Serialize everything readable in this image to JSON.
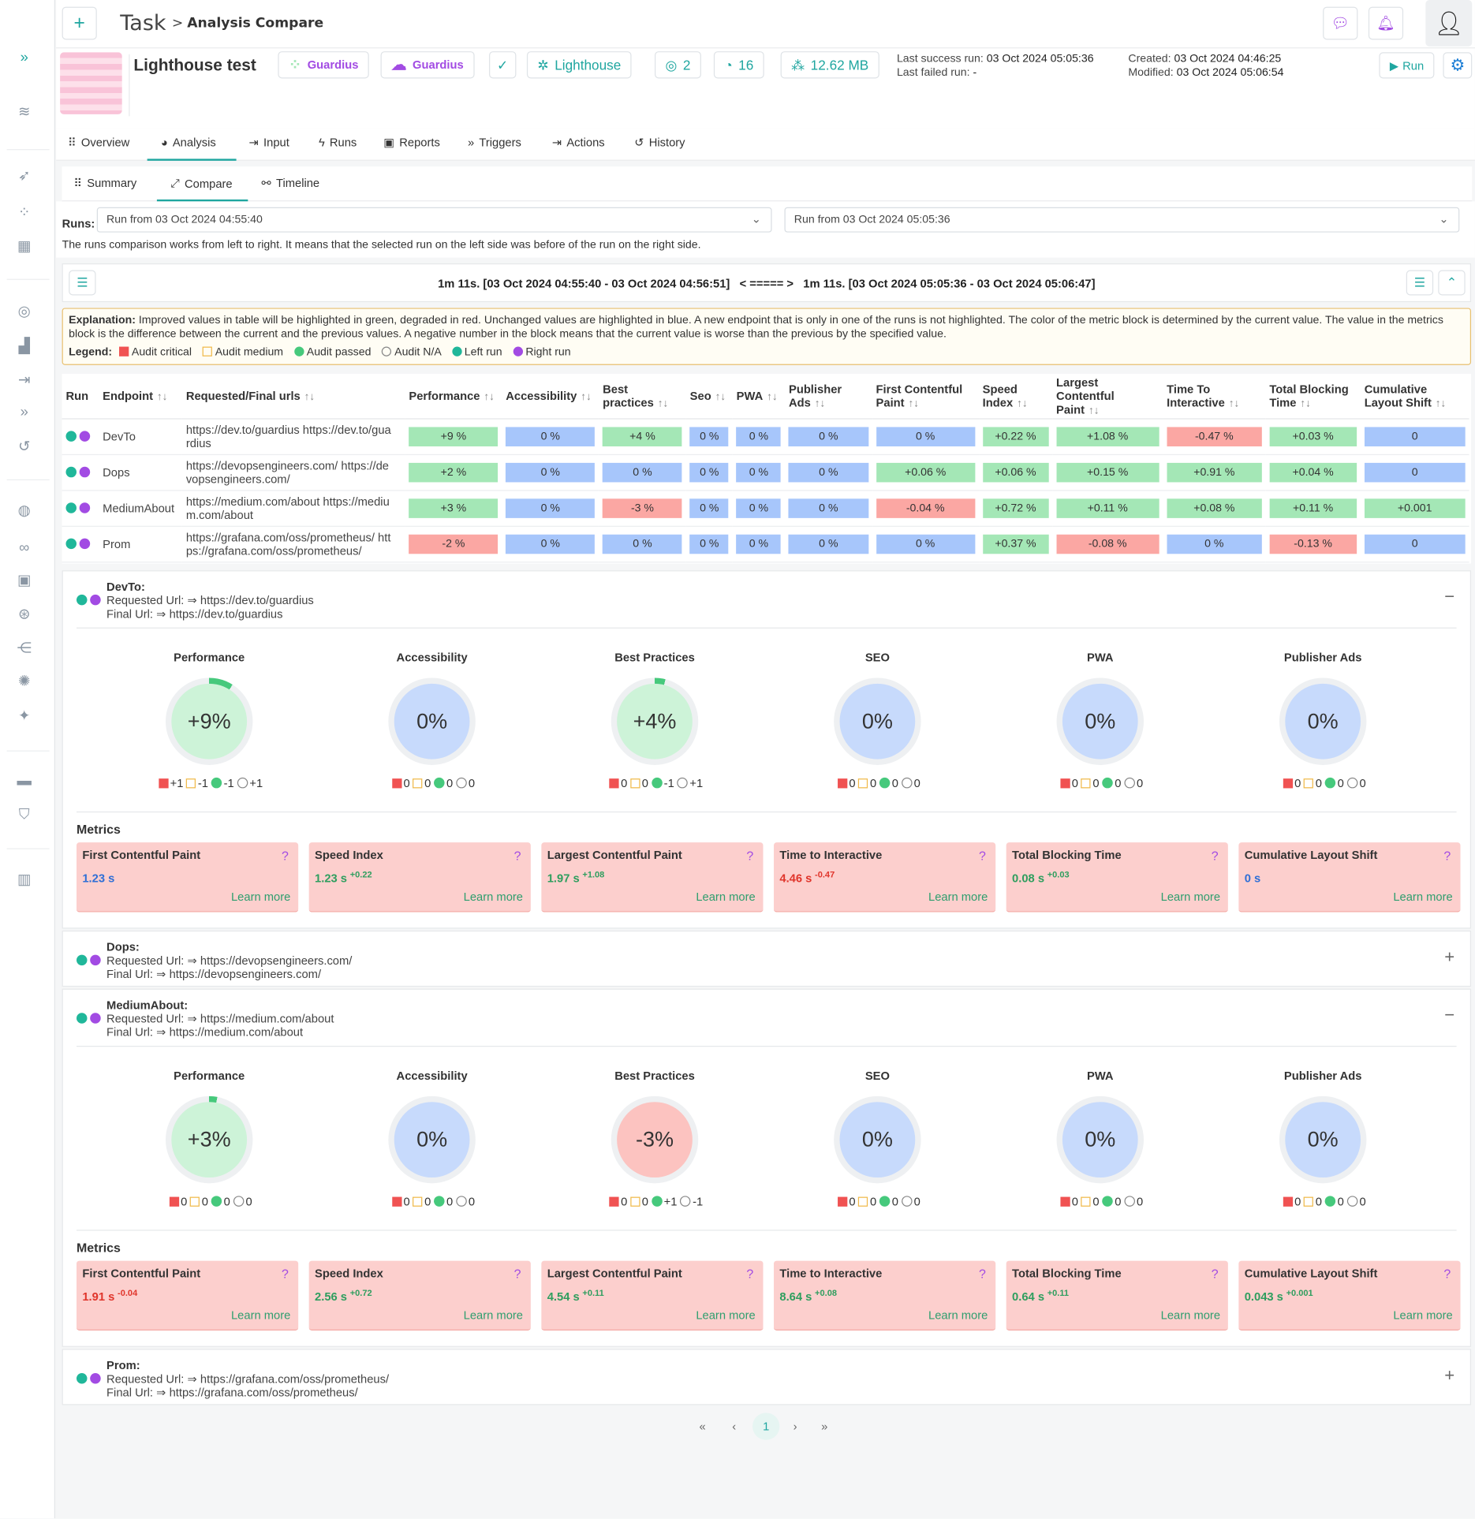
{
  "header": {
    "title": "Task",
    "crumb": "Analysis Compare",
    "plus": "+"
  },
  "task": {
    "name": "Lighthouse test",
    "tags": [
      "Guardius",
      "Guardius"
    ],
    "tool": "Lighthouse",
    "count_a": "2",
    "count_b": "16",
    "size": "12.62 MB",
    "last_success_label": "Last success run:",
    "last_success": "03 Oct 2024 05:05:36",
    "last_failed_label": "Last failed run:",
    "last_failed": "-",
    "created_label": "Created:",
    "created": "03 Oct 2024 04:46:25",
    "modified_label": "Modified:",
    "modified": "03 Oct 2024 05:06:54",
    "run_label": "Run"
  },
  "tabs": [
    "Overview",
    "Analysis",
    "Input",
    "Runs",
    "Reports",
    "Triggers",
    "Actions",
    "History"
  ],
  "subtabs": [
    "Summary",
    "Compare",
    "Timeline"
  ],
  "runs": {
    "label": "Runs:",
    "left": "Run from 03 Oct 2024 04:55:40",
    "right": "Run from 03 Oct 2024 05:05:36",
    "note": "The runs comparison works from left to right. It means that the selected run on the left side was before of the run on the right side.",
    "summary": "1m 11s. [03 Oct 2024 04:55:40 - 03 Oct 2024 04:56:51]   < ===== >   1m 11s. [03 Oct 2024 05:05:36 - 03 Oct 2024 05:06:47]"
  },
  "explanation": {
    "label": "Explanation:",
    "text": "Improved values in table will be highlighted in green, degraded in red. Unchanged values are highlighted in blue. A new endpoint that is only in one of the runs is not highlighted. The color of the metric block is determined by the current value. The value in the metrics block is the difference between the current and the previous values. A negative number in the block means that the current value is worse than the previous by the specified value.",
    "legend_label": "Legend:",
    "legend": [
      "Audit critical",
      "Audit medium",
      "Audit passed",
      "Audit N/A",
      "Left run",
      "Right run"
    ]
  },
  "table": {
    "headers": [
      "Run",
      "Endpoint",
      "Requested/Final urls",
      "Performance",
      "Accessibility",
      "Best practices",
      "Seo",
      "PWA",
      "Publisher Ads",
      "First Contentful Paint",
      "Speed Index",
      "Largest Contentful Paint",
      "Time To Interactive",
      "Total Blocking Time",
      "Cumulative Layout Shift"
    ],
    "rows": [
      {
        "endpoint": "DevTo",
        "urls": "https://dev.to/guardius https://dev.to/guardius",
        "cells": [
          [
            "+9 %",
            "g"
          ],
          [
            "0 %",
            "b"
          ],
          [
            "+4 %",
            "g"
          ],
          [
            "0 %",
            "b"
          ],
          [
            "0 %",
            "b"
          ],
          [
            "0 %",
            "b"
          ],
          [
            "0 %",
            "b"
          ],
          [
            "+0.22 %",
            "g"
          ],
          [
            "+1.08 %",
            "g"
          ],
          [
            "-0.47 %",
            "r"
          ],
          [
            "+0.03 %",
            "g"
          ],
          [
            "0",
            "b"
          ]
        ]
      },
      {
        "endpoint": "Dops",
        "urls": "https://devopsengineers.com/ https://devopsengineers.com/",
        "cells": [
          [
            "+2 %",
            "g"
          ],
          [
            "0 %",
            "b"
          ],
          [
            "0 %",
            "b"
          ],
          [
            "0 %",
            "b"
          ],
          [
            "0 %",
            "b"
          ],
          [
            "0 %",
            "b"
          ],
          [
            "+0.06 %",
            "g"
          ],
          [
            "+0.06 %",
            "g"
          ],
          [
            "+0.15 %",
            "g"
          ],
          [
            "+0.91 %",
            "g"
          ],
          [
            "+0.04 %",
            "g"
          ],
          [
            "0",
            "b"
          ]
        ]
      },
      {
        "endpoint": "MediumAbout",
        "urls": "https://medium.com/about https://medium.com/about",
        "cells": [
          [
            "+3 %",
            "g"
          ],
          [
            "0 %",
            "b"
          ],
          [
            "-3 %",
            "r"
          ],
          [
            "0 %",
            "b"
          ],
          [
            "0 %",
            "b"
          ],
          [
            "0 %",
            "b"
          ],
          [
            "-0.04 %",
            "r"
          ],
          [
            "+0.72 %",
            "g"
          ],
          [
            "+0.11 %",
            "g"
          ],
          [
            "+0.08 %",
            "g"
          ],
          [
            "+0.11 %",
            "g"
          ],
          [
            "+0.001",
            "g"
          ]
        ]
      },
      {
        "endpoint": "Prom",
        "urls": "https://grafana.com/oss/prometheus/ https://grafana.com/oss/prometheus/",
        "cells": [
          [
            "-2 %",
            "r"
          ],
          [
            "0 %",
            "b"
          ],
          [
            "0 %",
            "b"
          ],
          [
            "0 %",
            "b"
          ],
          [
            "0 %",
            "b"
          ],
          [
            "0 %",
            "b"
          ],
          [
            "0 %",
            "b"
          ],
          [
            "+0.37 %",
            "g"
          ],
          [
            "-0.08 %",
            "r"
          ],
          [
            "0 %",
            "b"
          ],
          [
            "-0.13 %",
            "r"
          ],
          [
            "0",
            "b"
          ]
        ]
      }
    ]
  },
  "endpoints": [
    {
      "name": "DevTo:",
      "req_label": "Requested Url:",
      "req": "https://dev.to/guardius",
      "fin_label": "Final Url:",
      "fin": "https://dev.to/guardius",
      "toggle": "−",
      "gauges": [
        {
          "title": "Performance",
          "value": "+9%",
          "c": "g",
          "arc": 9,
          "counts": [
            "+1",
            "-1",
            "-1",
            "+1"
          ]
        },
        {
          "title": "Accessibility",
          "value": "0%",
          "c": "b",
          "arc": 0,
          "counts": [
            "0",
            "0",
            "0",
            "0"
          ]
        },
        {
          "title": "Best Practices",
          "value": "+4%",
          "c": "g",
          "arc": 4,
          "counts": [
            "0",
            "0",
            "-1",
            "+1"
          ]
        },
        {
          "title": "SEO",
          "value": "0%",
          "c": "b",
          "arc": 0,
          "counts": [
            "0",
            "0",
            "0",
            "0"
          ]
        },
        {
          "title": "PWA",
          "value": "0%",
          "c": "b",
          "arc": 0,
          "counts": [
            "0",
            "0",
            "0",
            "0"
          ]
        },
        {
          "title": "Publisher Ads",
          "value": "0%",
          "c": "b",
          "arc": 0,
          "counts": [
            "0",
            "0",
            "0",
            "0"
          ]
        }
      ],
      "metrics_title": "Metrics",
      "metrics": [
        {
          "t": "First Contentful Paint",
          "v": "1.23 s",
          "d": "",
          "vc": "blue"
        },
        {
          "t": "Speed Index",
          "v": "1.23 s",
          "d": "+0.22",
          "vc": "green"
        },
        {
          "t": "Largest Contentful Paint",
          "v": "1.97 s",
          "d": "+1.08",
          "vc": "green"
        },
        {
          "t": "Time to Interactive",
          "v": "4.46 s",
          "d": "-0.47",
          "vc": "red"
        },
        {
          "t": "Total Blocking Time",
          "v": "0.08 s",
          "d": "+0.03",
          "vc": "green"
        },
        {
          "t": "Cumulative Layout Shift",
          "v": "0 s",
          "d": "",
          "vc": "blue"
        }
      ]
    },
    {
      "name": "Dops:",
      "req_label": "Requested Url:",
      "req": "https://devopsengineers.com/",
      "fin_label": "Final Url:",
      "fin": "https://devopsengineers.com/",
      "toggle": "+"
    },
    {
      "name": "MediumAbout:",
      "req_label": "Requested Url:",
      "req": "https://medium.com/about",
      "fin_label": "Final Url:",
      "fin": "https://medium.com/about",
      "toggle": "−",
      "gauges": [
        {
          "title": "Performance",
          "value": "+3%",
          "c": "g",
          "arc": 3,
          "counts": [
            "0",
            "0",
            "0",
            "0"
          ]
        },
        {
          "title": "Accessibility",
          "value": "0%",
          "c": "b",
          "arc": 0,
          "counts": [
            "0",
            "0",
            "0",
            "0"
          ]
        },
        {
          "title": "Best Practices",
          "value": "-3%",
          "c": "r",
          "arc": 0,
          "counts": [
            "0",
            "0",
            "+1",
            "-1"
          ]
        },
        {
          "title": "SEO",
          "value": "0%",
          "c": "b",
          "arc": 0,
          "counts": [
            "0",
            "0",
            "0",
            "0"
          ]
        },
        {
          "title": "PWA",
          "value": "0%",
          "c": "b",
          "arc": 0,
          "counts": [
            "0",
            "0",
            "0",
            "0"
          ]
        },
        {
          "title": "Publisher Ads",
          "value": "0%",
          "c": "b",
          "arc": 0,
          "counts": [
            "0",
            "0",
            "0",
            "0"
          ]
        }
      ],
      "metrics_title": "Metrics",
      "metrics": [
        {
          "t": "First Contentful Paint",
          "v": "1.91 s",
          "d": "-0.04",
          "vc": "red"
        },
        {
          "t": "Speed Index",
          "v": "2.56 s",
          "d": "+0.72",
          "vc": "green"
        },
        {
          "t": "Largest Contentful Paint",
          "v": "4.54 s",
          "d": "+0.11",
          "vc": "green"
        },
        {
          "t": "Time to Interactive",
          "v": "8.64 s",
          "d": "+0.08",
          "vc": "green"
        },
        {
          "t": "Total Blocking Time",
          "v": "0.64 s",
          "d": "+0.11",
          "vc": "green"
        },
        {
          "t": "Cumulative Layout Shift",
          "v": "0.043 s",
          "d": "+0.001",
          "vc": "green"
        }
      ]
    },
    {
      "name": "Prom:",
      "req_label": "Requested Url:",
      "req": "https://grafana.com/oss/prometheus/",
      "fin_label": "Final Url:",
      "fin": "https://grafana.com/oss/prometheus/",
      "toggle": "+"
    }
  ],
  "learn_more": "Learn more",
  "pager": {
    "first": "«",
    "prev": "‹",
    "page": "1",
    "next": "›",
    "last": "»"
  },
  "colors": {
    "teal": "#1fa6a0",
    "purple": "#a24be3",
    "green": "#a4e7b6",
    "red": "#fba7a3",
    "blue": "#a7c6fb"
  }
}
